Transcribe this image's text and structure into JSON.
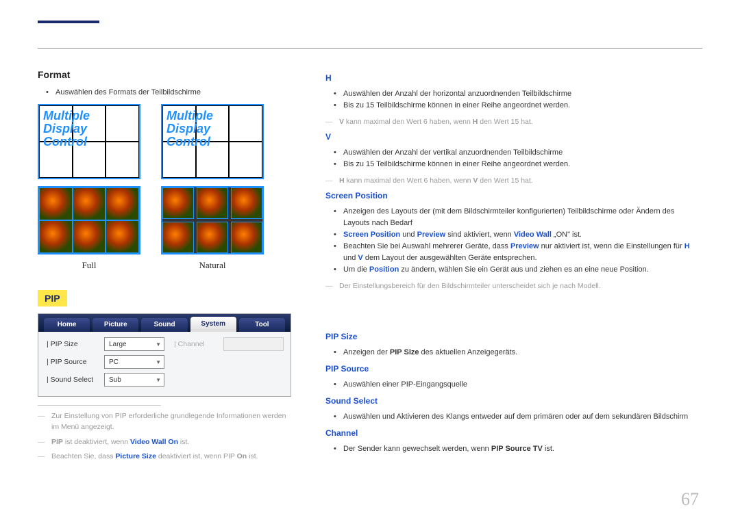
{
  "pageNumber": "67",
  "left": {
    "formatHeading": "Format",
    "formatBullet": "Auswählen des Formats der Teilbildschirme",
    "mdcText": "Multiple\nDisplay\nControl",
    "captionFull": "Full",
    "captionNatural": "Natural",
    "pipBadge": "PIP",
    "tabs": {
      "home": "Home",
      "picture": "Picture",
      "sound": "Sound",
      "system": "System",
      "tool": "Tool"
    },
    "pipRows": {
      "pipSizeLabel": "| PIP Size",
      "pipSizeValue": "Large",
      "pipSourceLabel": "| PIP Source",
      "pipSourceValue": "PC",
      "soundSelectLabel": "| Sound Select",
      "soundSelectValue": "Sub",
      "channelLabel": "| Channel"
    },
    "note1_a": "Zur Einstellung von PIP erforderliche grundlegende Informationen werden im Menü angezeigt.",
    "note2_a": "PIP",
    "note2_b": " ist deaktiviert, wenn ",
    "note2_c": "Video Wall On",
    "note2_d": " ist.",
    "note3_a": "Beachten Sie, dass ",
    "note3_b": "Picture Size",
    "note3_c": " deaktiviert ist, wenn PIP ",
    "note3_d": "On",
    "note3_e": " ist."
  },
  "right": {
    "h": {
      "heading": "H",
      "b1": "Auswählen der Anzahl der horizontal anzuordnenden Teilbildschirme",
      "b2": "Bis zu 15 Teilbildschirme können in einer Reihe angeordnet werden.",
      "note_a": "V",
      "note_b": " kann maximal den Wert 6 haben, wenn ",
      "note_c": "H",
      "note_d": " den Wert 15 hat."
    },
    "v": {
      "heading": "V",
      "b1": "Auswählen der Anzahl der vertikal anzuordnenden Teilbildschirme",
      "b2": "Bis zu 15 Teilbildschirme können in einer Reihe angeordnet werden.",
      "note_a": "H",
      "note_b": " kann maximal den Wert 6 haben, wenn ",
      "note_c": "V",
      "note_d": " den Wert 15 hat."
    },
    "sp": {
      "heading": "Screen Position",
      "b1": "Anzeigen des Layouts der (mit dem Bildschirmteiler konfigurierten) Teilbildschirme oder Ändern des Layouts nach Bedarf",
      "b2_a": "Screen Position",
      "b2_b": " und ",
      "b2_c": "Preview",
      "b2_d": " sind aktiviert, wenn ",
      "b2_e": "Video Wall",
      "b2_f": " „ON\" ist.",
      "b3_a": "Beachten Sie bei Auswahl mehrerer Geräte, dass ",
      "b3_b": "Preview",
      "b3_c": " nur aktiviert ist, wenn die Einstellungen für ",
      "b3_d": "H",
      "b3_e": " und ",
      "b3_f": "V",
      "b3_g": " dem Layout der ausgewählten Geräte entsprechen.",
      "b4_a": "Um die ",
      "b4_b": "Position",
      "b4_c": " zu ändern, wählen Sie ein Gerät aus und ziehen es an eine neue Position.",
      "note": "Der Einstellungsbereich für den Bildschirmteiler unterscheidet sich je nach Modell."
    },
    "pipSize": {
      "heading": "PIP Size",
      "b_a": "Anzeigen der ",
      "b_b": "PIP Size",
      "b_c": " des aktuellen Anzeigegeräts."
    },
    "pipSource": {
      "heading": "PIP Source",
      "b": "Auswählen einer PIP-Eingangsquelle"
    },
    "soundSelect": {
      "heading": "Sound Select",
      "b": "Auswählen und Aktivieren des Klangs entweder auf dem primären oder auf dem sekundären Bildschirm"
    },
    "channel": {
      "heading": "Channel",
      "b_a": "Der Sender kann gewechselt werden, wenn ",
      "b_b": "PIP Source TV",
      "b_c": " ist."
    }
  }
}
